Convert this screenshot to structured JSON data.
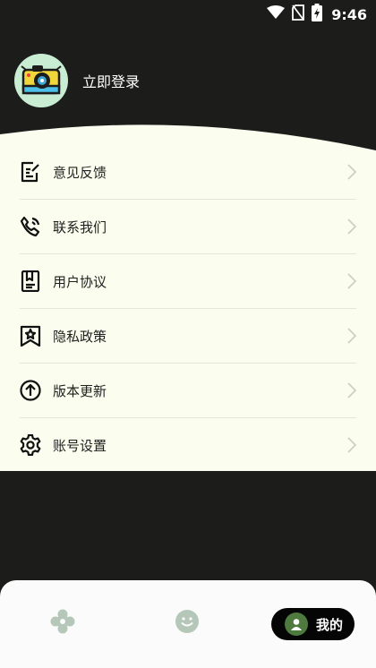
{
  "status_bar": {
    "time": "9:46",
    "icons": [
      "wifi-icon",
      "no-sim-icon",
      "battery-charging-icon"
    ]
  },
  "profile": {
    "login_label": "立即登录",
    "avatar_icon": "camera-icon"
  },
  "menu": {
    "items": [
      {
        "label": "意见反馈",
        "icon": "feedback-icon"
      },
      {
        "label": "联系我们",
        "icon": "phone-icon"
      },
      {
        "label": "用户协议",
        "icon": "book-icon"
      },
      {
        "label": "隐私政策",
        "icon": "bookmark-star-icon"
      },
      {
        "label": "版本更新",
        "icon": "arrow-up-circle-icon"
      },
      {
        "label": "账号设置",
        "icon": "gear-icon"
      }
    ]
  },
  "tabbar": {
    "tabs": [
      {
        "icon": "flower-icon",
        "active": false
      },
      {
        "icon": "smile-icon",
        "active": false
      },
      {
        "icon": "user-icon",
        "label": "我的",
        "active": true
      }
    ]
  },
  "colors": {
    "background": "#1c1c1b",
    "panel": "#fbfdee",
    "accent_green": "#4f7a3f",
    "avatar_bg": "#c8edd3"
  }
}
